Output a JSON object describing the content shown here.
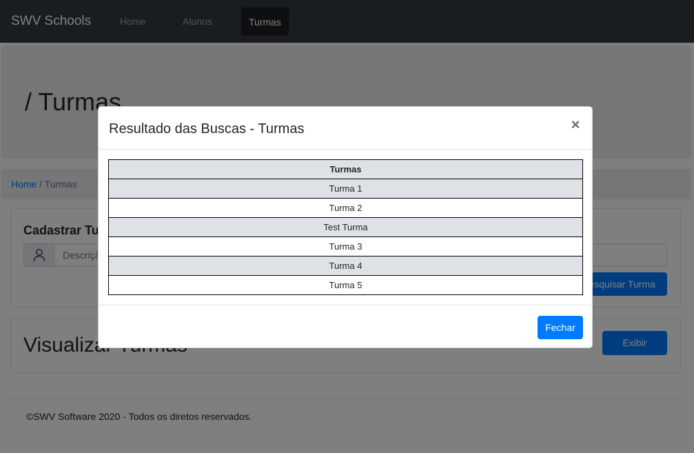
{
  "navbar": {
    "brand": "SWV Schools",
    "links": [
      {
        "label": "Home"
      },
      {
        "label": "Alunos"
      },
      {
        "label": "Turmas"
      }
    ]
  },
  "jumbotron": {
    "title": "/ Turmas"
  },
  "breadcrumb": {
    "home": "Home",
    "separator": " / ",
    "current": "Turmas"
  },
  "register_card": {
    "title": "Cadastrar Turma",
    "input_placeholder": "Descrição",
    "search_button": "Pesquisar Turma",
    "icon": "user-icon"
  },
  "view_card": {
    "title": "Visualizar Turmas",
    "show_button": "Exibir"
  },
  "footer": {
    "text": "©SWV Software 2020 - Todos os diretos reservados."
  },
  "modal": {
    "title": "Resultado das Buscas - Turmas",
    "close_symbol": "×",
    "table_header": "Turmas",
    "rows": [
      "Turma 1",
      "Turma 2",
      "Test Turma",
      "Turma 3",
      "Turma 4",
      "Turma 5"
    ],
    "close_button": "Fechar"
  },
  "colors": {
    "navbar": "#343a40",
    "primary": "#007bff",
    "muted_bg": "#e9ecef",
    "table_shade": "#dee2e6"
  }
}
